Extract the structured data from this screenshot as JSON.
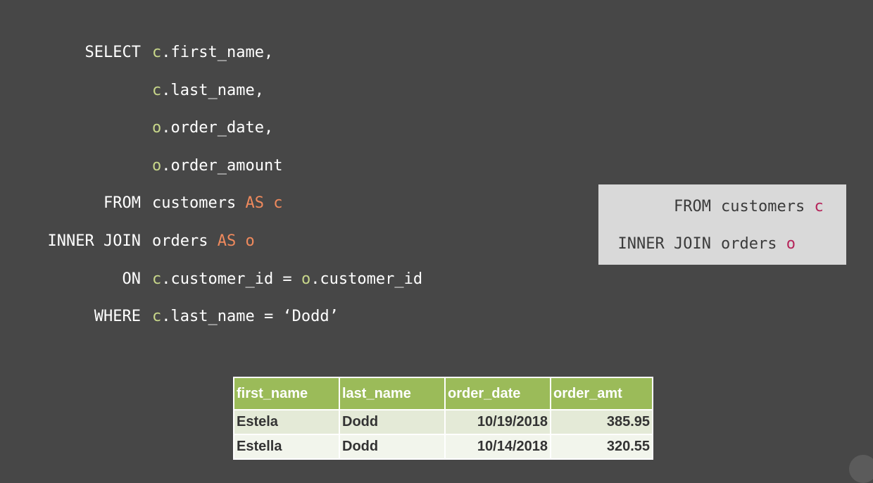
{
  "code": {
    "lines": [
      {
        "kw": "SELECT",
        "rest": [
          {
            "t": "c",
            "cls": "ag"
          },
          {
            "t": ".first_name,",
            "cls": ""
          }
        ]
      },
      {
        "kw": "",
        "rest": [
          {
            "t": "c",
            "cls": "ag"
          },
          {
            "t": ".last_name,",
            "cls": ""
          }
        ]
      },
      {
        "kw": "",
        "rest": [
          {
            "t": "o",
            "cls": "ag"
          },
          {
            "t": ".order_date,",
            "cls": ""
          }
        ]
      },
      {
        "kw": "",
        "rest": [
          {
            "t": "o",
            "cls": "ag"
          },
          {
            "t": ".order_amount",
            "cls": ""
          }
        ]
      },
      {
        "kw": "FROM",
        "rest": [
          {
            "t": "customers ",
            "cls": ""
          },
          {
            "t": "AS c",
            "cls": "ao"
          }
        ]
      },
      {
        "kw": "INNER JOIN",
        "rest": [
          {
            "t": "orders ",
            "cls": ""
          },
          {
            "t": "AS o",
            "cls": "ao"
          }
        ]
      },
      {
        "kw": "ON",
        "rest": [
          {
            "t": "c",
            "cls": "ag"
          },
          {
            "t": ".customer_id = ",
            "cls": ""
          },
          {
            "t": "o",
            "cls": "ag"
          },
          {
            "t": ".customer_id",
            "cls": ""
          }
        ]
      },
      {
        "kw": "WHERE",
        "rest": [
          {
            "t": "c",
            "cls": "ag"
          },
          {
            "t": ".last_name = ‘Dodd’",
            "cls": ""
          }
        ]
      }
    ]
  },
  "callout": {
    "lines": [
      {
        "kw": "FROM",
        "rest": "customers ",
        "alias": "c"
      },
      {
        "kw": "INNER JOIN",
        "rest": "orders ",
        "alias": "o"
      }
    ]
  },
  "result_table": {
    "headers": [
      "first_name",
      "last_name",
      "order_date",
      "order_amt"
    ],
    "rows": [
      [
        "Estela",
        "Dodd",
        "10/19/2018",
        "385.95"
      ],
      [
        "Estella",
        "Dodd",
        "10/14/2018",
        "320.55"
      ]
    ]
  },
  "colors": {
    "background": "#474747",
    "alias_green": "#c8d78a",
    "as_orange": "#f08a5d",
    "callout_alias": "#b5245a",
    "table_header": "#9bbb59"
  },
  "icons": {
    "player": "player-logo-icon"
  }
}
